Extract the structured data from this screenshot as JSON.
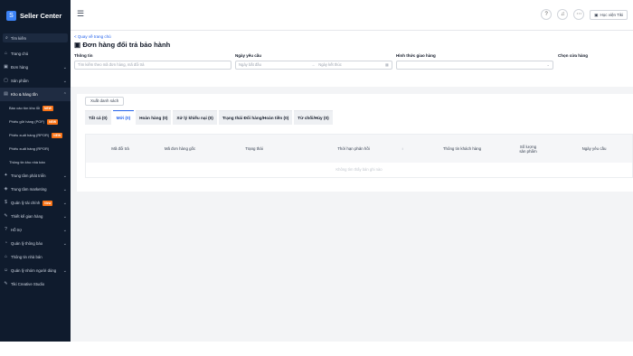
{
  "brand": {
    "name": "Seller Center",
    "logo": "S"
  },
  "search": {
    "placeholder": "Tìm kiếm"
  },
  "sidebar": {
    "items": [
      {
        "label": "Trang chủ",
        "icon": "home-icon",
        "glyph": "⌂",
        "chevron": ""
      },
      {
        "label": "Đơn hàng",
        "icon": "cart-icon",
        "glyph": "▣",
        "chevron": "⌄"
      },
      {
        "label": "Sản phẩm",
        "icon": "box-icon",
        "glyph": "▢",
        "chevron": "⌄"
      },
      {
        "label": "Kho & hàng tồn",
        "icon": "warehouse-icon",
        "glyph": "▤",
        "chevron": "⌃"
      }
    ],
    "sub_items": [
      {
        "label": "Báo cáo tồn kho lỗi",
        "badge": "NEW"
      },
      {
        "label": "Phiếu gửi hàng (POF)",
        "badge": "NEW"
      },
      {
        "label": "Phiếu xuất hàng (RPOR)",
        "badge": "NEW"
      },
      {
        "label": "Phiếu xuất hàng (RPOR)",
        "badge": ""
      },
      {
        "label": "Thông tin kho nhà bán",
        "badge": ""
      }
    ],
    "items2": [
      {
        "label": "Trung tâm phát triển",
        "icon": "growth-icon",
        "glyph": "✦",
        "chevron": "⌄",
        "badge": ""
      },
      {
        "label": "Trung tâm marketing",
        "icon": "megaphone-icon",
        "glyph": "◈",
        "chevron": "⌄",
        "badge": ""
      },
      {
        "label": "Quản lý tài chính",
        "icon": "wallet-icon",
        "glyph": "$",
        "chevron": "⌄",
        "badge": "New"
      },
      {
        "label": "Thiết kế gian hàng",
        "icon": "brush-icon",
        "glyph": "✎",
        "chevron": "⌄",
        "badge": ""
      },
      {
        "label": "Hỗ trợ",
        "icon": "help-icon",
        "glyph": "?",
        "chevron": "⌄",
        "badge": ""
      },
      {
        "label": "Quản lý thông báo",
        "icon": "bell-icon",
        "glyph": "◔",
        "chevron": "⌄",
        "badge": ""
      },
      {
        "label": "Thông tin nhà bán",
        "icon": "store-icon",
        "glyph": "⌂",
        "chevron": "",
        "badge": ""
      },
      {
        "label": "Quản lý nhóm người dùng",
        "icon": "users-icon",
        "glyph": "☺",
        "chevron": "⌄",
        "badge": ""
      },
      {
        "label": "Tiki Creative Studio",
        "icon": "studio-icon",
        "glyph": "✎",
        "chevron": "",
        "badge": ""
      }
    ]
  },
  "topbar": {
    "menu_icon": "☰",
    "help_icon": "?",
    "bell_icon": "♫",
    "more_icon": "⋯",
    "learn_icon": "▣",
    "learn_label": "Học viện Tiki"
  },
  "header": {
    "back_label": "< Quay về trang chủ",
    "title": "Đơn hàng đổi trả bảo hành",
    "title_icon": "▣"
  },
  "filters": {
    "info_label": "Thông tin",
    "info_placeholder": "Tìm kiếm theo mã đơn hàng, mã đổi trả",
    "date_label": "Ngày yêu cầu",
    "date_start_placeholder": "Ngày bắt đầu",
    "date_arrow": "→",
    "date_end_placeholder": "Ngày kết thúc",
    "calendar_icon": "▦",
    "delivery_label": "Hình thức giao hàng",
    "delivery_value": "",
    "dropdown_icon": "⌄",
    "store_label": "Chọn cửa hàng"
  },
  "card": {
    "export_label": "Xuất danh sách",
    "tabs": [
      {
        "label": "Tất cả (0)",
        "active": false
      },
      {
        "label": "Mới (0)",
        "active": true
      },
      {
        "label": "Hoàn hàng (0)",
        "active": false
      },
      {
        "label": "Xử lý khiếu nại (0)",
        "active": false
      },
      {
        "label": "Trạng thái Đổi hàng/Hoàn tiền (0)",
        "active": false
      },
      {
        "label": "Từ chối/Hủy (0)",
        "active": false
      }
    ],
    "columns": [
      "Mã đổi trả",
      "Mã đơn hàng gốc",
      "Trạng thái",
      "Thời hạn phản hồi",
      "Thông tin khách hàng",
      "Số lượng sản phẩm",
      "Ngày yêu cầu"
    ],
    "sort_icon": "↕",
    "empty_text": "Không tìm thấy bản ghi nào"
  }
}
